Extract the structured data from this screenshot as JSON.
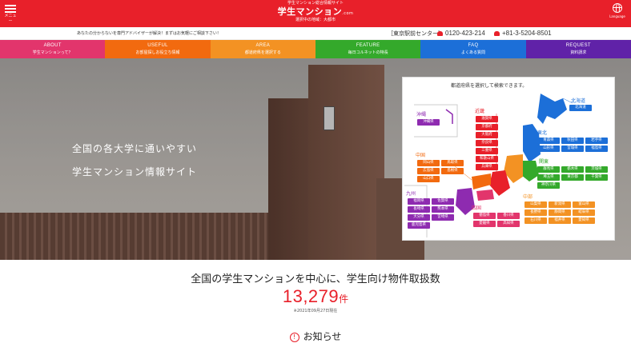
{
  "header": {
    "menu_label": "メニュー",
    "tagline": "学生マンション総合情報サイト",
    "logo": "学生マンション",
    "logo_suffix": ".com",
    "area": "選択中の地域：大都市",
    "language_label": "Language",
    "brand_color": "#e8202a"
  },
  "subbar": {
    "text": "あなたの分からないを専門アドバイザーが解決！まずはお気軽にご相談下さい！",
    "branch": "［東京駅前センター］",
    "phone1": "0120-423-214",
    "phone2": "+81-3-5204-8501"
  },
  "nav": [
    {
      "en": "ABOUT",
      "jp": "学生マンションって？",
      "color": "#e2356c"
    },
    {
      "en": "USEFUL",
      "jp": "お部屋探しお役立ち情報",
      "color": "#f26a0f"
    },
    {
      "en": "AREA",
      "jp": "都道府県を選択する",
      "color": "#f39223"
    },
    {
      "en": "FEATURE",
      "jp": "毎日コルネットの特長",
      "color": "#34a92b"
    },
    {
      "en": "FAQ",
      "jp": "よくある質問",
      "color": "#1c6fd8"
    },
    {
      "en": "REQUEST",
      "jp": "資料請求",
      "color": "#6022a8"
    }
  ],
  "hero": {
    "line1": "全国の各大学に通いやすい",
    "line2": "学生マンション情報サイト"
  },
  "map": {
    "title": "都道府県を選択して検索できます。",
    "regions": {
      "okinawa": "沖縄",
      "kinki": "近畿",
      "hokkaido": "北海道",
      "tohoku": "東北",
      "kanto": "関東",
      "chugoku": "中国",
      "kyushu": "九州",
      "shikoku": "四国",
      "chubu": "中部"
    },
    "prefs": {
      "okinawa": [
        "沖縄県"
      ],
      "kinki": [
        "滋賀県",
        "京都府",
        "大阪府",
        "奈良県",
        "三重県",
        "和歌山県",
        "兵庫県"
      ],
      "hokkaido": [
        "北海道"
      ],
      "tohoku": [
        "青森県",
        "秋田県",
        "岩手県",
        "山形県",
        "宮城県",
        "福島県"
      ],
      "kanto": [
        "群馬県",
        "栃木県",
        "茨城県",
        "埼玉県",
        "東京都",
        "千葉県",
        "神奈川県"
      ],
      "chugoku": [
        "岡山県",
        "鳥取県",
        "広島県",
        "島根県",
        "山口県"
      ],
      "kyushu": [
        "福岡県",
        "佐賀県",
        "長崎県",
        "熊本県",
        "大分県",
        "宮崎県",
        "鹿児島県"
      ],
      "shikoku": [
        "徳島県",
        "香川県",
        "愛媛県",
        "高知県"
      ],
      "chubu": [
        "山梨県",
        "新潟県",
        "富山県",
        "長野県",
        "静岡県",
        "岐阜県",
        "石川県",
        "福井県",
        "愛知県"
      ]
    },
    "colors": {
      "okinawa": "#8e2bb0",
      "kinki": "#e8202a",
      "hokkaido": "#1c6fd8",
      "tohoku": "#1c6fd8",
      "kanto": "#34a92b",
      "chugoku": "#f26a0f",
      "kyushu": "#8e2bb0",
      "shikoku": "#e2356c",
      "chubu": "#f39223"
    }
  },
  "main": {
    "heading": "全国の学生マンションを中心に、学生向け物件取扱数",
    "count": "13,279",
    "count_unit": "件",
    "count_date": "※2021年09月27日現在",
    "news_label": "お知らせ"
  }
}
